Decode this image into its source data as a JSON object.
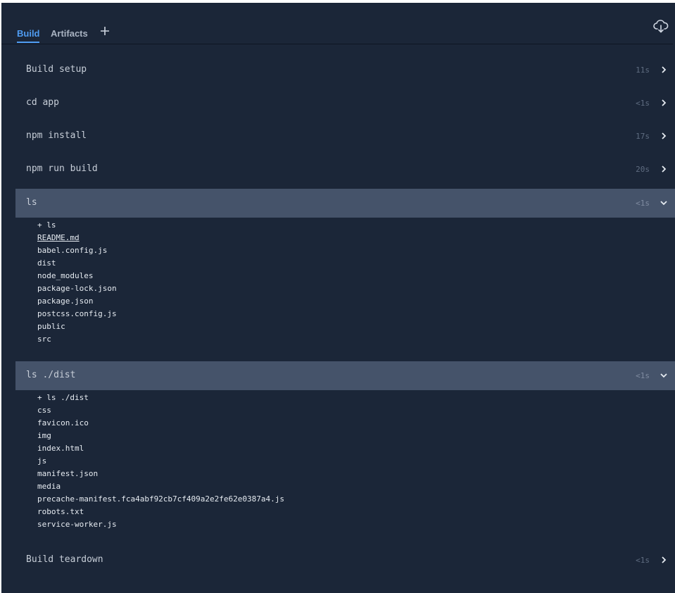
{
  "tabs": {
    "build_label": "Build",
    "artifacts_label": "Artifacts",
    "add_icon": "plus-icon",
    "download_icon": "cloud-download-icon"
  },
  "colors": {
    "background": "#1b2638",
    "active_tab": "#4f9cf2",
    "expanded_row": "#45536a"
  },
  "steps": [
    {
      "name": "Build setup",
      "duration": "11s",
      "expanded": false
    },
    {
      "name": "cd app",
      "duration": "<1s",
      "expanded": false
    },
    {
      "name": "npm install",
      "duration": "17s",
      "expanded": false
    },
    {
      "name": "npm run build",
      "duration": "20s",
      "expanded": false
    },
    {
      "name": "ls",
      "duration": "<1s",
      "expanded": true,
      "output": [
        "+ ls",
        "README.md",
        "babel.config.js",
        "dist",
        "node_modules",
        "package-lock.json",
        "package.json",
        "postcss.config.js",
        "public",
        "src"
      ]
    },
    {
      "name": "ls ./dist",
      "duration": "<1s",
      "expanded": true,
      "output": [
        "+ ls ./dist",
        "css",
        "favicon.ico",
        "img",
        "index.html",
        "js",
        "manifest.json",
        "media",
        "precache-manifest.fca4abf92cb7cf409a2e2fe62e0387a4.js",
        "robots.txt",
        "service-worker.js"
      ]
    },
    {
      "name": "Build teardown",
      "duration": "<1s",
      "expanded": false
    }
  ]
}
